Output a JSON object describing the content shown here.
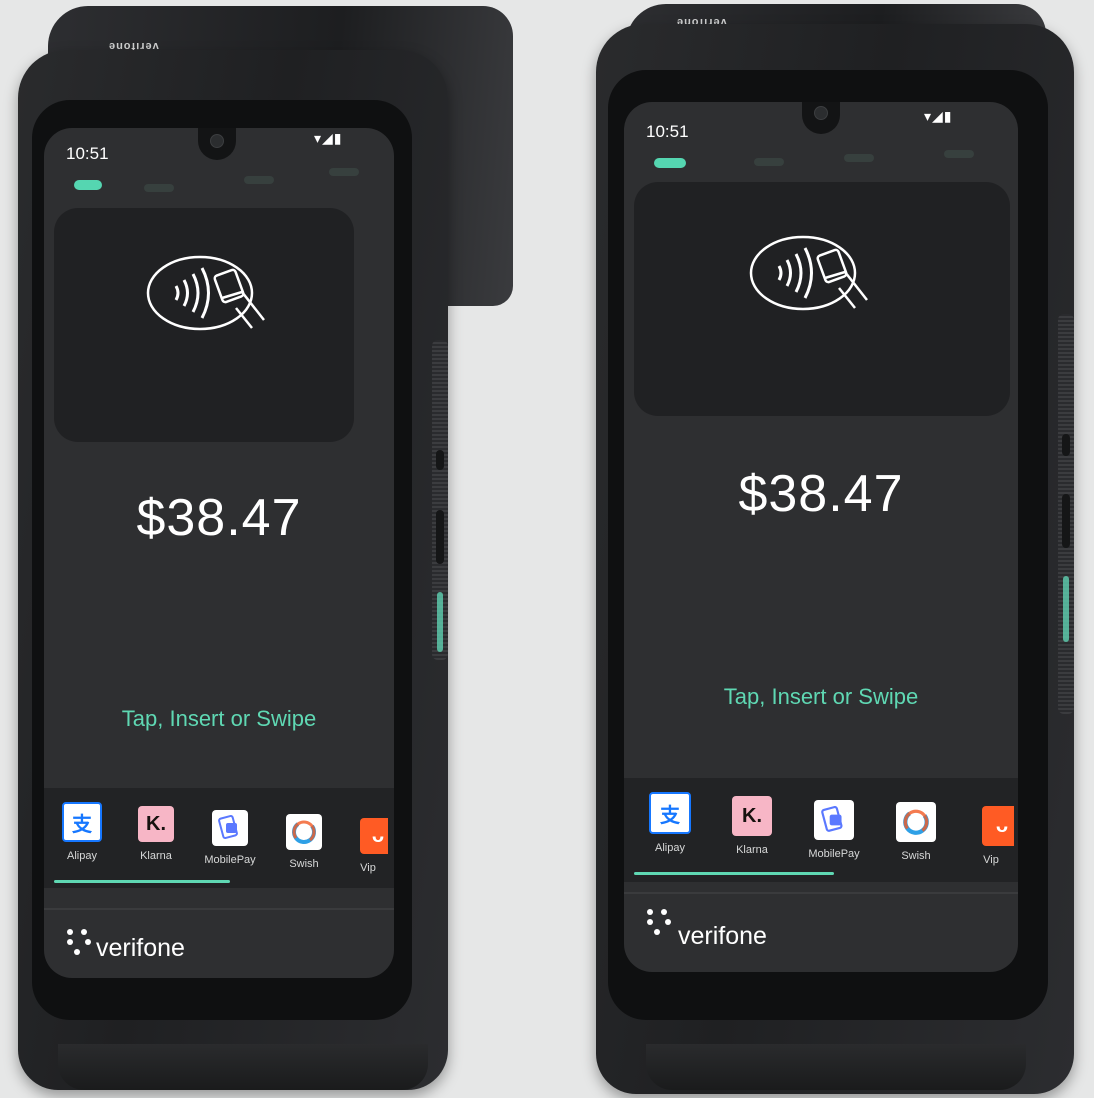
{
  "device_brand": "verifone",
  "terminals": [
    {
      "status": {
        "time": "10:51",
        "icons": "▾◢▮"
      },
      "amount": "$38.47",
      "prompt": "Tap, Insert or Swipe",
      "payment_methods": [
        {
          "label": "Alipay",
          "glyph": "支"
        },
        {
          "label": "Klarna",
          "glyph": "K."
        },
        {
          "label": "MobilePay",
          "glyph": ""
        },
        {
          "label": "Swish",
          "glyph": ""
        },
        {
          "label": "Vip",
          "glyph": "ᴗ"
        }
      ],
      "brand": "verifone",
      "hood_label": "verifone"
    },
    {
      "status": {
        "time": "10:51",
        "icons": "▾◢▮"
      },
      "amount": "$38.47",
      "prompt": "Tap, Insert or Swipe",
      "payment_methods": [
        {
          "label": "Alipay",
          "glyph": "支"
        },
        {
          "label": "Klarna",
          "glyph": "K."
        },
        {
          "label": "MobilePay",
          "glyph": ""
        },
        {
          "label": "Swish",
          "glyph": ""
        },
        {
          "label": "Vip",
          "glyph": "ᴗ"
        }
      ],
      "brand": "verifone",
      "hood_label": "verifone"
    }
  ],
  "colors": {
    "accent": "#5fd8b3",
    "alipay": "#1677ff",
    "klarna": "#f7b6c6",
    "vipps": "#ff5b24"
  }
}
